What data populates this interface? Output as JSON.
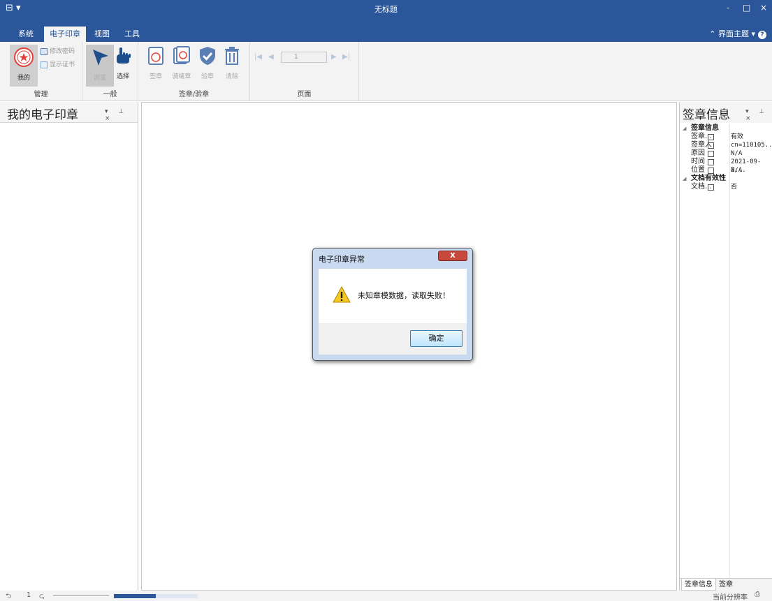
{
  "window": {
    "title": "无标题",
    "minimize": "-",
    "maximize": "□",
    "close": "×",
    "quick_access": "⊟ ▾"
  },
  "tabs": [
    "系统",
    "电子印章",
    "视图",
    "工具"
  ],
  "active_tab": "电子印章",
  "theme_menu": "⌃ 界面主题 ▾",
  "help": "?",
  "ribbon": {
    "groups": {
      "manage": "管理",
      "general": "一般",
      "sign_verify": "签章/验章",
      "page": "页面"
    },
    "buttons": {
      "mine": "我的",
      "change_password": "修改密码",
      "show_cert": "显示证书",
      "browse": "浏览",
      "select": "选择",
      "sign": "签章",
      "seam_sign": "骑缝章",
      "verify": "验章",
      "clear": "清除"
    },
    "page_number": "1"
  },
  "left_panel": {
    "title": "我的电子印章",
    "controls": "▾ ⊥ ×"
  },
  "right_panel": {
    "title": "签章信息",
    "controls": "▾ ⊥ ×",
    "categories": [
      {
        "name": "签章信息",
        "rows": [
          {
            "key": "签章...",
            "value": "有效"
          },
          {
            "key": "签章人",
            "value": "cn=110105..."
          },
          {
            "key": "原因",
            "value": "N/A"
          },
          {
            "key": "时间",
            "value": "2021-09-2..."
          },
          {
            "key": "位置",
            "value": "N/A"
          }
        ]
      },
      {
        "name": "文档有效性",
        "rows": [
          {
            "key": "文档...",
            "value": "否"
          }
        ]
      }
    ],
    "bottom_tabs": [
      "签章信息",
      "签章"
    ]
  },
  "statusbar": {
    "page": "1",
    "resolution_label": "当前分辨率",
    "progress": 0.5
  },
  "dialog": {
    "title": "电子印章异常",
    "close": "X",
    "message": "未知章模数据，读取失败！",
    "ok": "确定"
  },
  "colors": {
    "accent": "#2b579a",
    "ribbon_bg": "#f3f3f3",
    "seal_red": "#e0413c"
  }
}
